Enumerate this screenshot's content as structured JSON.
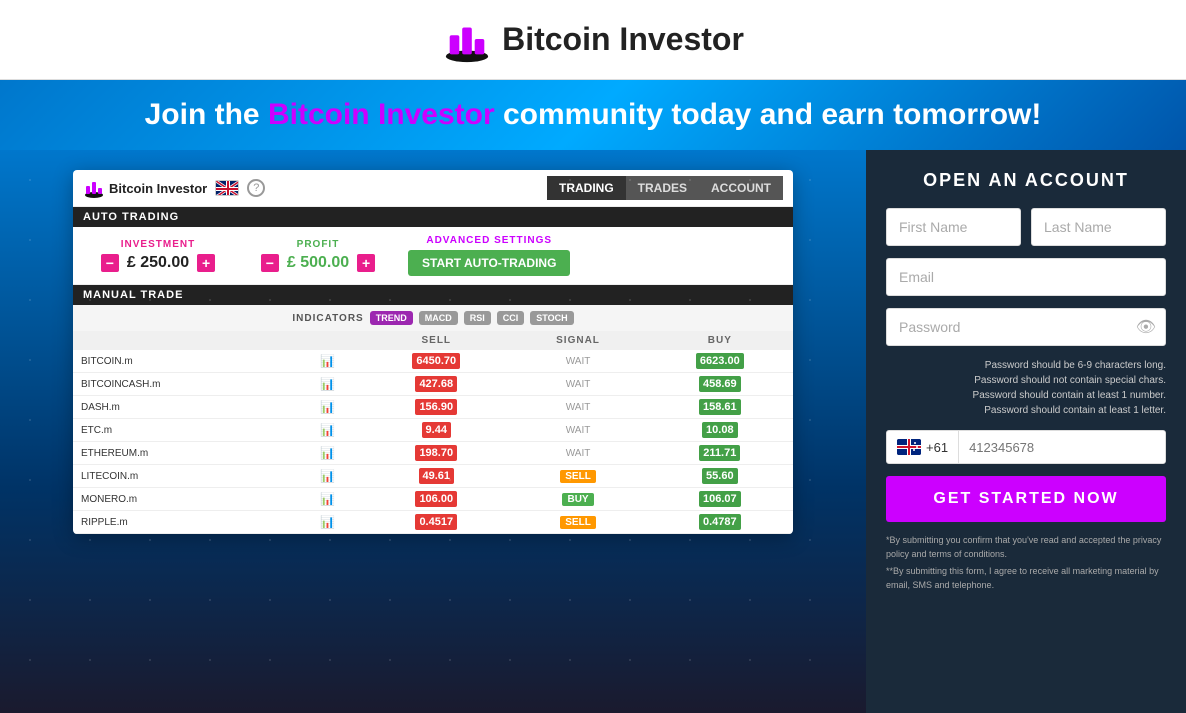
{
  "header": {
    "title": "Bitcoin Investor"
  },
  "hero": {
    "text_before": "Join the ",
    "brand": "Bitcoin Investor",
    "text_after": " community today and earn tomorrow!"
  },
  "widget": {
    "title": "Bitcoin Investor",
    "tabs": [
      {
        "label": "TRADING",
        "active": true
      },
      {
        "label": "TRADES",
        "active": false
      },
      {
        "label": "ACCOUNT",
        "active": false
      }
    ],
    "auto_trading_label": "AUTO TRADING",
    "investment_label": "INVESTMENT",
    "investment_value": "£ 250.00",
    "profit_label": "PROFIT",
    "profit_value": "£ 500.00",
    "advanced_label": "ADVANCED SETTINGS",
    "start_btn": "START AUTO-TRADING",
    "manual_trade_label": "MANUAL TRADE",
    "indicators_label": "INDICATORS",
    "indicator_badges": [
      "TREND",
      "MACD",
      "RSI",
      "CCI",
      "STOCH"
    ],
    "table_headers": [
      "",
      "",
      "SELL",
      "SIGNAL",
      "BUY"
    ],
    "rows": [
      {
        "name": "BITCOIN.m",
        "sell": "6450.70",
        "signal": "WAIT",
        "buy": "6623.00"
      },
      {
        "name": "BITCOINCASH.m",
        "sell": "427.68",
        "signal": "WAIT",
        "buy": "458.69"
      },
      {
        "name": "DASH.m",
        "sell": "156.90",
        "signal": "WAIT",
        "buy": "158.61"
      },
      {
        "name": "ETC.m",
        "sell": "9.44",
        "signal": "WAIT",
        "buy": "10.08"
      },
      {
        "name": "ETHEREUM.m",
        "sell": "198.70",
        "signal": "WAIT",
        "buy": "211.71"
      },
      {
        "name": "LITECOIN.m",
        "sell": "49.61",
        "signal": "SELL",
        "buy": "55.60"
      },
      {
        "name": "MONERO.m",
        "sell": "106.00",
        "signal": "BUY",
        "buy": "106.07"
      },
      {
        "name": "RIPPLE.m",
        "sell": "0.4517",
        "signal": "SELL",
        "buy": "0.4787"
      }
    ]
  },
  "registration": {
    "title": "OPEN AN ACCOUNT",
    "first_name_placeholder": "First Name",
    "last_name_placeholder": "Last Name",
    "email_placeholder": "Email",
    "password_placeholder": "Password",
    "password_hint1": "Password should be 6-9 characters long.",
    "password_hint2": "Password should not contain special chars.",
    "password_hint3": "Password should contain at least 1 number.",
    "password_hint4": "Password should contain at least 1 letter.",
    "country_code": "+61",
    "phone_placeholder": "412345678",
    "cta_button": "GET STARTED NOW",
    "disclaimer1": "*By submitting you confirm that you've read and accepted the privacy policy and terms of conditions.",
    "disclaimer2": "**By submitting this form, I agree to receive all marketing material by email, SMS and telephone."
  }
}
